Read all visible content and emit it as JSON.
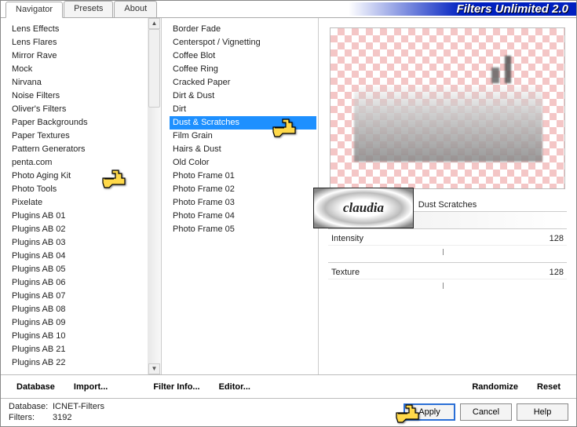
{
  "header": {
    "tabs": [
      "Navigator",
      "Presets",
      "About"
    ],
    "active_tab": 0,
    "title": "Filters Unlimited 2.0"
  },
  "categories": [
    "Lens Effects",
    "Lens Flares",
    "Mirror Rave",
    "Mock",
    "Nirvana",
    "Noise Filters",
    "Oliver's Filters",
    "Paper Backgrounds",
    "Paper Textures",
    "Pattern Generators",
    "penta.com",
    "Photo Aging Kit",
    "Photo Tools",
    "Pixelate",
    "Plugins AB 01",
    "Plugins AB 02",
    "Plugins AB 03",
    "Plugins AB 04",
    "Plugins AB 05",
    "Plugins AB 06",
    "Plugins AB 07",
    "Plugins AB 08",
    "Plugins AB 09",
    "Plugins AB 10",
    "Plugins AB 21",
    "Plugins AB 22"
  ],
  "categories_highlight_index": 11,
  "filters": [
    "Border Fade",
    "Centerspot / Vignetting",
    "Coffee Blot",
    "Coffee Ring",
    "Cracked Paper",
    "Dirt & Dust",
    "Dirt",
    "Dust & Scratches",
    "Film Grain",
    "Hairs & Dust",
    "Old Color",
    "Photo Frame 01",
    "Photo Frame 02",
    "Photo Frame 03",
    "Photo Frame 04",
    "Photo Frame 05"
  ],
  "filters_selected_index": 7,
  "watermark": "claudia",
  "filter_name_display": "Dust  Scratches",
  "params": [
    {
      "label": "Intensity",
      "value": "128"
    },
    {
      "label": "Texture",
      "value": "128"
    }
  ],
  "action_links": {
    "database": "Database",
    "import": "Import...",
    "filter_info": "Filter Info...",
    "editor": "Editor...",
    "randomize": "Randomize",
    "reset": "Reset"
  },
  "footer": {
    "db_label": "Database:",
    "db_value": "ICNET-Filters",
    "filters_label": "Filters:",
    "filters_value": "3192",
    "apply": "Apply",
    "cancel": "Cancel",
    "help": "Help"
  }
}
